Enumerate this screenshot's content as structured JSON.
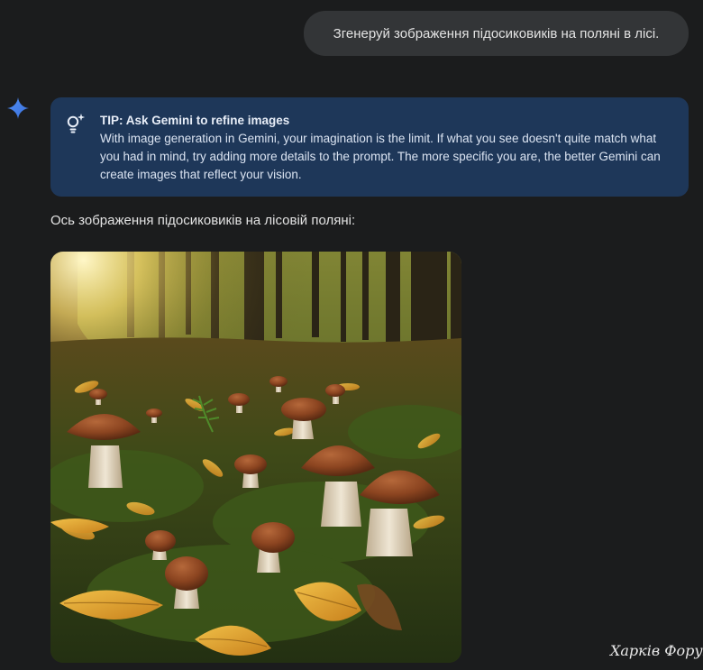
{
  "user_message": {
    "text": "Згенеруй зображення підосиковиків на поляні в лісі."
  },
  "tip": {
    "icon": "lightbulb-sparkle-icon",
    "title": "TIP: Ask Gemini to refine images",
    "body": "With image generation in Gemini, your imagination is the limit. If what you see doesn't quite match what you had in mind, try adding more details to the prompt. The more specific you are, the better Gemini can create images that reflect your vision."
  },
  "response": {
    "avatar_icon": "gemini-spark-icon",
    "text": "Ось зображення підосиковиків на лісовій поляні:",
    "image_description_icon": "generated-image"
  },
  "watermark": {
    "text": "Харків Форум"
  },
  "colors": {
    "background": "#1b1c1d",
    "user_bubble": "#333537",
    "tip_card": "#1e3759",
    "gemini_blue": "#4a85f5"
  }
}
